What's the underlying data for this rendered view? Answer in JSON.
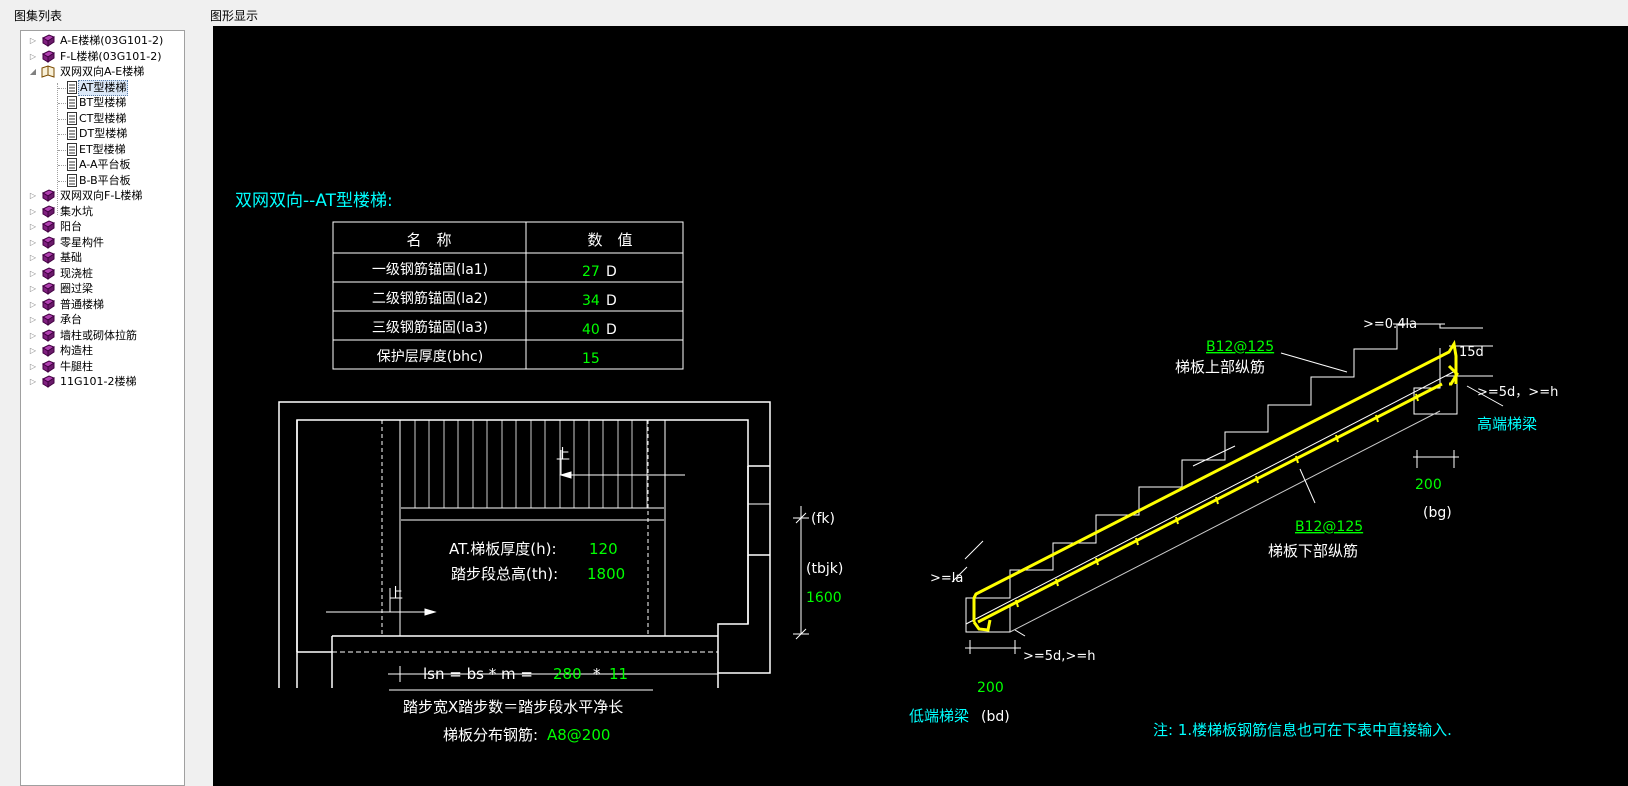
{
  "left_panel": {
    "title": "图集列表",
    "tree": [
      {
        "label": "A-E楼梯(03G101-2)",
        "level": 0,
        "expanded": false
      },
      {
        "label": "F-L楼梯(03G101-2)",
        "level": 0,
        "expanded": false
      },
      {
        "label": "双网双向A-E楼梯",
        "level": 0,
        "expanded": true
      },
      {
        "label": "AT型楼梯",
        "level": 1,
        "selected": true
      },
      {
        "label": "BT型楼梯",
        "level": 1
      },
      {
        "label": "CT型楼梯",
        "level": 1
      },
      {
        "label": "DT型楼梯",
        "level": 1
      },
      {
        "label": "ET型楼梯",
        "level": 1
      },
      {
        "label": "A-A平台板",
        "level": 1
      },
      {
        "label": "B-B平台板",
        "level": 1
      },
      {
        "label": "双网双向F-L楼梯",
        "level": 0,
        "expanded": false
      },
      {
        "label": "集水坑",
        "level": 0,
        "expanded": false
      },
      {
        "label": "阳台",
        "level": 0,
        "expanded": false
      },
      {
        "label": "零星构件",
        "level": 0,
        "expanded": false
      },
      {
        "label": "基础",
        "level": 0,
        "expanded": false
      },
      {
        "label": "现浇桩",
        "level": 0,
        "expanded": false
      },
      {
        "label": "圈过梁",
        "level": 0,
        "expanded": false
      },
      {
        "label": "普通楼梯",
        "level": 0,
        "expanded": false
      },
      {
        "label": "承台",
        "level": 0,
        "expanded": false
      },
      {
        "label": "墙柱或砌体拉筋",
        "level": 0,
        "expanded": false
      },
      {
        "label": "构造柱",
        "level": 0,
        "expanded": false
      },
      {
        "label": "牛腿柱",
        "level": 0,
        "expanded": false
      },
      {
        "label": "11G101-2楼梯",
        "level": 0,
        "expanded": false
      }
    ]
  },
  "graphic": {
    "title": "图形显示",
    "heading": "双网双向--AT型楼梯:",
    "table": {
      "header": [
        "名　称",
        "数　值"
      ],
      "rows": [
        {
          "name": "一级钢筋锚固(la1)",
          "value": "27",
          "unit": "D"
        },
        {
          "name": "二级钢筋锚固(la2)",
          "value": "34",
          "unit": "D"
        },
        {
          "name": "三级钢筋锚固(la3)",
          "value": "40",
          "unit": "D"
        },
        {
          "name": "保护层厚度(bhc)",
          "value": "15",
          "unit": ""
        }
      ]
    },
    "plan": {
      "up1": "上",
      "up2": "上",
      "thickness_label": "AT.梯板厚度(h):",
      "thickness_value": "120",
      "height_label": "踏步段总高(th):",
      "height_value": "1800",
      "fk": "(fk)",
      "tbjk": "(tbjk)",
      "tbjk_value": "1600",
      "formula_left": "lsn = bs * m =",
      "bs_value": "280",
      "formula_mul": "*",
      "m_value": "11",
      "caption": "踏步宽X踏步数＝踏步段水平净长",
      "dist_label": "梯板分布钢筋:",
      "dist_value": "A8@200"
    },
    "section": {
      "top_bar_value": "B12@125",
      "top_bar_label": "梯板上部纵筋",
      "bottom_bar_value": "B12@125",
      "bottom_bar_label": "梯板下部纵筋",
      "anchor_top": ">=0.4la",
      "hook_15d": "15d",
      "high_extend": ">=5d，>=h",
      "high_beam_label": "高端梯梁",
      "high_beam_value": "200",
      "high_beam_code": "(bg)",
      "low_anchor": ">=la",
      "low_extend": ">=5d,>=h",
      "low_beam_value": "200",
      "low_beam_label": "低端梯梁",
      "low_beam_code": "(bd)"
    },
    "note": "注: 1.楼梯板钢筋信息也可在下表中直接输入."
  },
  "colors": {
    "cad_white": "#ffffff",
    "cad_green": "#00ff00",
    "cad_cyan": "#00ffff",
    "cad_yellow": "#ffff00"
  }
}
